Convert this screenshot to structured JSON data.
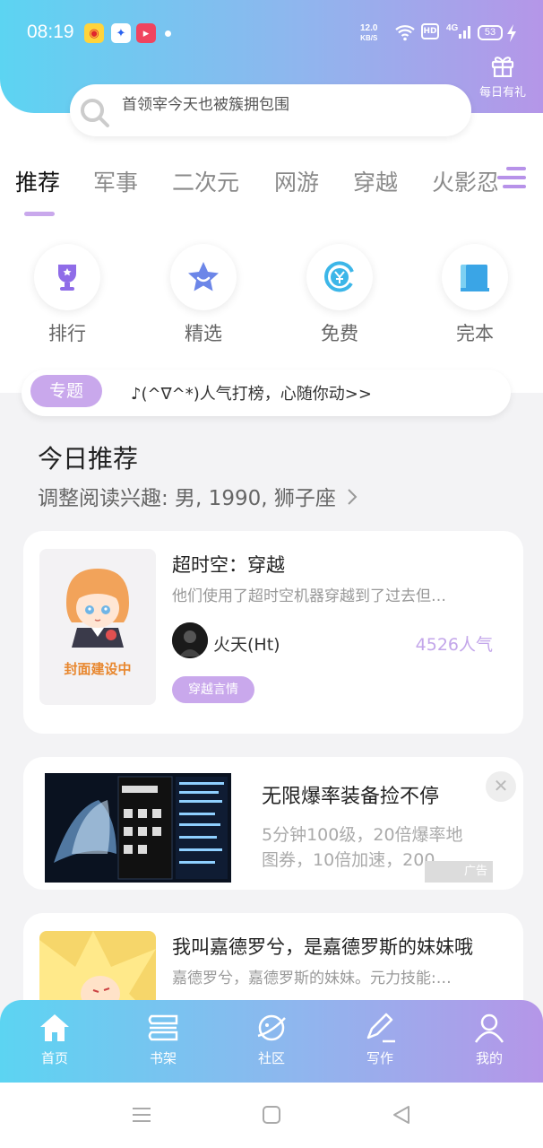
{
  "status_bar": {
    "time": "08:19",
    "net_speed_value": "12.0",
    "net_speed_unit": "KB/S",
    "hd": "HD",
    "signal": "4G",
    "battery": "53"
  },
  "header": {
    "gift_label": "每日有礼",
    "search_placeholder": "首领宰今天也被簇拥包围"
  },
  "tabs": [
    "推荐",
    "军事",
    "二次元",
    "网游",
    "穿越",
    "火影忍"
  ],
  "quick_links": [
    {
      "label": "排行",
      "icon": "trophy-icon",
      "color": "#8f6ce8"
    },
    {
      "label": "精选",
      "icon": "star-icon",
      "color": "#6c86e8"
    },
    {
      "label": "免费",
      "icon": "yen-coin-icon",
      "color": "#3cb6e8"
    },
    {
      "label": "完本",
      "icon": "book-icon",
      "color": "#3aa5e6"
    }
  ],
  "topic": {
    "badge": "专题",
    "text": "♪(^∇^*)人气打榜，心随你动>>"
  },
  "section": {
    "title": "今日推荐",
    "subtitle": "调整阅读兴趣: 男, 1990, 狮子座"
  },
  "books": [
    {
      "cover_text": "封面建设中",
      "title": "超时空：穿越",
      "desc": "他们使用了超时空机器穿越到了过去但…",
      "author": "火天(Ht)",
      "popularity": "4526人气",
      "tag": "穿越言情"
    },
    {
      "title": "我叫嘉德罗兮，是嘉德罗斯的妹妹哦",
      "desc": "嘉德罗兮，嘉德罗斯的妹妹。元力技能:…"
    }
  ],
  "ad": {
    "title": "无限爆率装备捡不停",
    "desc_line1": "5分钟100级，20倍爆率地",
    "desc_line2": "图券，10倍加速，200…",
    "label": "广告"
  },
  "bottom_nav": [
    "首页",
    "书架",
    "社区",
    "写作",
    "我的"
  ],
  "colors": {
    "accent": "#c9a8ec",
    "gradient_start": "#5cd4f2",
    "gradient_end": "#b596e8"
  }
}
